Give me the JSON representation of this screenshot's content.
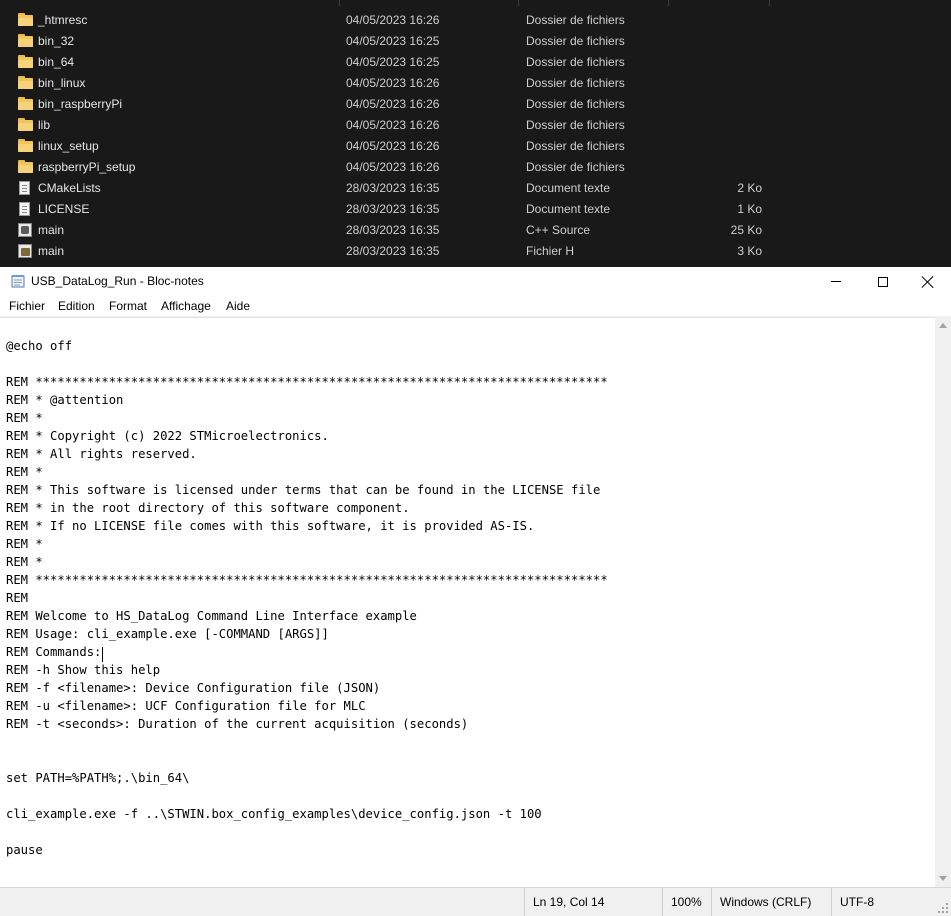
{
  "explorer": {
    "files": [
      {
        "name": "_htmresc",
        "date": "04/05/2023 16:26",
        "type": "Dossier de fichiers",
        "size": "",
        "icon": "folder-icon"
      },
      {
        "name": "bin_32",
        "date": "04/05/2023 16:25",
        "type": "Dossier de fichiers",
        "size": "",
        "icon": "folder-icon"
      },
      {
        "name": "bin_64",
        "date": "04/05/2023 16:25",
        "type": "Dossier de fichiers",
        "size": "",
        "icon": "folder-icon"
      },
      {
        "name": "bin_linux",
        "date": "04/05/2023 16:26",
        "type": "Dossier de fichiers",
        "size": "",
        "icon": "folder-icon"
      },
      {
        "name": "bin_raspberryPi",
        "date": "04/05/2023 16:26",
        "type": "Dossier de fichiers",
        "size": "",
        "icon": "folder-icon"
      },
      {
        "name": "lib",
        "date": "04/05/2023 16:26",
        "type": "Dossier de fichiers",
        "size": "",
        "icon": "folder-icon"
      },
      {
        "name": "linux_setup",
        "date": "04/05/2023 16:26",
        "type": "Dossier de fichiers",
        "size": "",
        "icon": "folder-icon"
      },
      {
        "name": "raspberryPi_setup",
        "date": "04/05/2023 16:26",
        "type": "Dossier de fichiers",
        "size": "",
        "icon": "folder-icon"
      },
      {
        "name": "CMakeLists",
        "date": "28/03/2023 16:35",
        "type": "Document texte",
        "size": "2 Ko",
        "icon": "text-file-icon"
      },
      {
        "name": "LICENSE",
        "date": "28/03/2023 16:35",
        "type": "Document texte",
        "size": "1 Ko",
        "icon": "text-file-icon"
      },
      {
        "name": "main",
        "date": "28/03/2023 16:35",
        "type": "C++ Source",
        "size": "25 Ko",
        "icon": "cpp-file-icon"
      },
      {
        "name": "main",
        "date": "28/03/2023 16:35",
        "type": "Fichier H",
        "size": "3 Ko",
        "icon": "header-file-icon"
      }
    ]
  },
  "notepad": {
    "title": "USB_DataLog_Run - Bloc-notes",
    "menu": [
      "Fichier",
      "Edition",
      "Format",
      "Affichage",
      "Aide"
    ],
    "lines": [
      "@echo off",
      "",
      "REM ******************************************************************************",
      "REM * @attention",
      "REM *",
      "REM * Copyright (c) 2022 STMicroelectronics.",
      "REM * All rights reserved.",
      "REM *",
      "REM * This software is licensed under terms that can be found in the LICENSE file",
      "REM * in the root directory of this software component.",
      "REM * If no LICENSE file comes with this software, it is provided AS-IS.",
      "REM *",
      "REM *",
      "REM ******************************************************************************",
      "REM",
      "REM Welcome to HS_DataLog Command Line Interface example",
      "REM Usage: cli_example.exe [-COMMAND [ARGS]]",
      "REM Commands:",
      "REM -h Show this help",
      "REM -f <filename>: Device Configuration file (JSON)",
      "REM -u <filename>: UCF Configuration file for MLC",
      "REM -t <seconds>: Duration of the current acquisition (seconds)",
      "",
      "",
      "set PATH=%PATH%;.\\bin_64\\",
      "",
      "cli_example.exe -f ..\\STWIN.box_config_examples\\device_config.json -t 100",
      "",
      "pause"
    ],
    "caret": {
      "line": 19,
      "col": 14
    },
    "status": {
      "position": "Ln 19, Col 14",
      "zoom": "100%",
      "line_ending": "Windows (CRLF)",
      "encoding": "UTF-8"
    }
  },
  "colors": {
    "explorer_bg": "#191919",
    "folder": "#f2c55c",
    "notepad_bg": "#ffffff",
    "statusbar_bg": "#f0f0f0"
  }
}
